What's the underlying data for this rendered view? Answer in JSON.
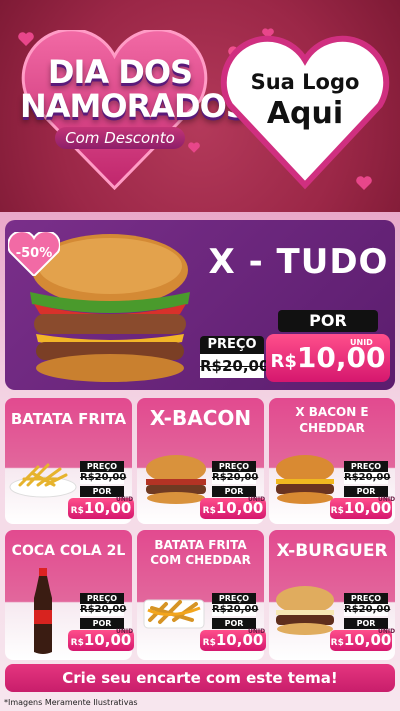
{
  "header": {
    "title_line1": "DIA DOS",
    "title_line2": "NAMORADOS",
    "subtitle": "Com Desconto",
    "logo_line1": "Sua Logo",
    "logo_line2": "Aqui"
  },
  "featured": {
    "name": "X - TUDO",
    "discount": "-50%",
    "preco_label": "PREÇO",
    "old_price": "R$20,00",
    "por_label": "POR",
    "currency": "R$",
    "new_price": "10,00",
    "unit": "UNID"
  },
  "products": [
    {
      "name": "BATATA FRITA",
      "preco_label": "PREÇO",
      "old_price": "R$20,00",
      "por_label": "POR",
      "currency": "R$",
      "price": "10,00",
      "unit": "UNID"
    },
    {
      "name": "X-BACON",
      "preco_label": "PREÇO",
      "old_price": "R$20,00",
      "por_label": "POR",
      "currency": "R$",
      "price": "10,00",
      "unit": "UNID"
    },
    {
      "name": "X BACON E CHEDDAR",
      "preco_label": "PREÇO",
      "old_price": "R$20,00",
      "por_label": "POR",
      "currency": "R$",
      "price": "10,00",
      "unit": "UNID"
    },
    {
      "name": "COCA COLA 2L",
      "preco_label": "PREÇO",
      "old_price": "R$20,00",
      "por_label": "POR",
      "currency": "R$",
      "price": "10,00",
      "unit": "UNID"
    },
    {
      "name": "BATATA FRITA COM CHEDDAR",
      "preco_label": "PREÇO",
      "old_price": "R$20,00",
      "por_label": "POR",
      "currency": "R$",
      "price": "10,00",
      "unit": "UNID"
    },
    {
      "name": "X-BURGUER",
      "preco_label": "PREÇO",
      "old_price": "R$20,00",
      "por_label": "POR",
      "currency": "R$",
      "price": "10,00",
      "unit": "UNID"
    }
  ],
  "footer": {
    "cta": "Crie seu encarte com este tema!",
    "disclaimer": "*Imagens Meramente Ilustrativas"
  },
  "colors": {
    "header_red": "#9b2747",
    "hero_purple": "#6a2580",
    "pink": "#e2468c",
    "price_pink": "#e8306f"
  }
}
